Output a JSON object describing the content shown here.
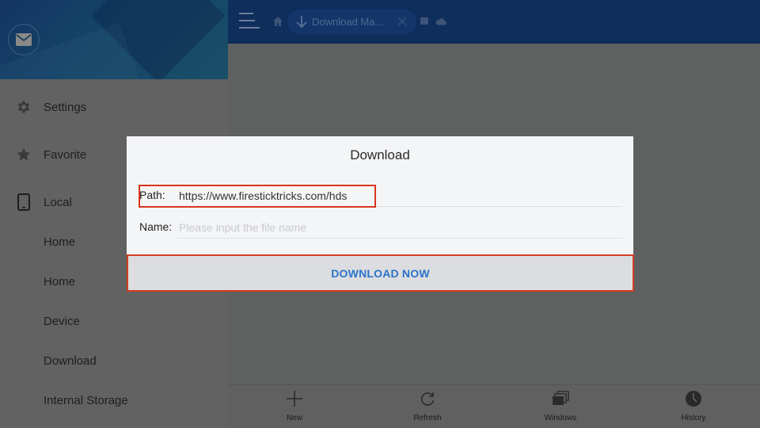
{
  "sidebar": {
    "header": {
      "avatar_icon": "mail-icon"
    },
    "items": [
      {
        "label": "Settings",
        "icon": "gear-icon"
      },
      {
        "label": "Favorite",
        "icon": "star-icon"
      },
      {
        "label": "Local",
        "icon": "phone-icon"
      },
      {
        "label": "Home"
      },
      {
        "label": "Home"
      },
      {
        "label": "Device"
      },
      {
        "label": "Download"
      },
      {
        "label": "Internal Storage"
      }
    ]
  },
  "topbar": {
    "menu_icon": "hamburger-icon",
    "home_icon": "home-icon",
    "tab": {
      "label": "Download Ma...",
      "icon": "download-arrow-icon",
      "close_icon": "close-icon"
    },
    "extra_icons": [
      "windows-icon",
      "cloud-icon"
    ]
  },
  "dialog": {
    "title": "Download",
    "path": {
      "label": "Path:",
      "value": "https://www.firesticktricks.com/hds"
    },
    "name": {
      "label": "Name:",
      "placeholder": "Please input the file name",
      "value": ""
    },
    "button_label": "DOWNLOAD NOW",
    "highlight_color": "#d9361e",
    "accent_color": "#2a73c9"
  },
  "bottombar": {
    "items": [
      {
        "label": "New",
        "icon": "plus-icon"
      },
      {
        "label": "Refresh",
        "icon": "refresh-icon"
      },
      {
        "label": "Windows",
        "icon": "windows-stack-icon"
      },
      {
        "label": "History",
        "icon": "clock-icon"
      }
    ]
  }
}
